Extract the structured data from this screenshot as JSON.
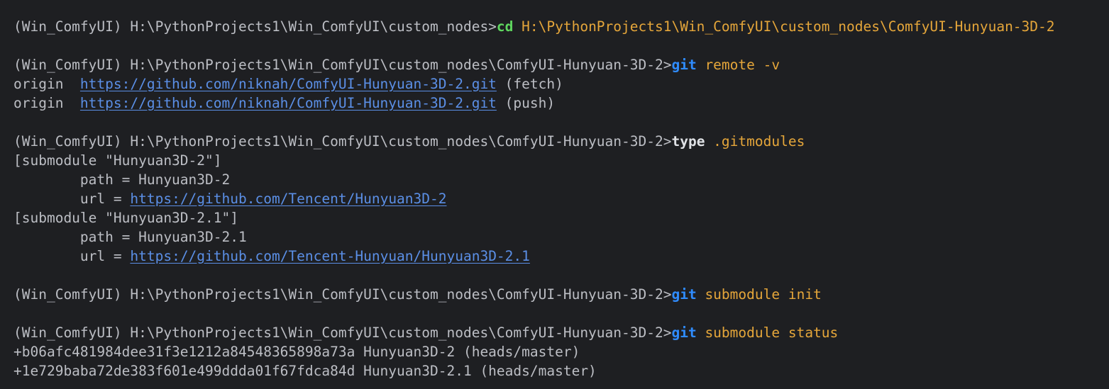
{
  "terminal": {
    "lines": [
      {
        "prompt": "(Win_ComfyUI) H:\\PythonProjects1\\Win_ComfyUI\\custom_nodes>",
        "command": "cd",
        "args": " H:\\PythonProjects1\\Win_ComfyUI\\custom_nodes\\ComfyUI-Hunyuan-3D-2"
      },
      {
        "prompt": "(Win_ComfyUI) H:\\PythonProjects1\\Win_ComfyUI\\custom_nodes\\ComfyUI-Hunyuan-3D-2>",
        "command": "git",
        "args": " remote -v"
      },
      {
        "pre": "origin  ",
        "link": "https://github.com/niknah/ComfyUI-Hunyuan-3D-2.git",
        "post": " (fetch)"
      },
      {
        "pre": "origin  ",
        "link": "https://github.com/niknah/ComfyUI-Hunyuan-3D-2.git",
        "post": " (push)"
      },
      {
        "prompt": "(Win_ComfyUI) H:\\PythonProjects1\\Win_ComfyUI\\custom_nodes\\ComfyUI-Hunyuan-3D-2>",
        "command": "type",
        "args": " .gitmodules"
      },
      {
        "text": "[submodule \"Hunyuan3D-2\"]"
      },
      {
        "text": "        path = Hunyuan3D-2"
      },
      {
        "pre": "        url = ",
        "link": "https://github.com/Tencent/Hunyuan3D-2"
      },
      {
        "text": "[submodule \"Hunyuan3D-2.1\"]"
      },
      {
        "text": "        path = Hunyuan3D-2.1"
      },
      {
        "pre": "        url = ",
        "link": "https://github.com/Tencent-Hunyuan/Hunyuan3D-2.1"
      },
      {
        "prompt": "(Win_ComfyUI) H:\\PythonProjects1\\Win_ComfyUI\\custom_nodes\\ComfyUI-Hunyuan-3D-2>",
        "command": "git",
        "args": " submodule init"
      },
      {
        "prompt": "(Win_ComfyUI) H:\\PythonProjects1\\Win_ComfyUI\\custom_nodes\\ComfyUI-Hunyuan-3D-2>",
        "command": "git",
        "args": " submodule status"
      },
      {
        "text": "+b06afc481984dee31f3e1212a84548365898a73a Hunyuan3D-2 (heads/master)"
      },
      {
        "text": "+1e729baba72de383f601e499ddda01f67fdca84d Hunyuan3D-2.1 (heads/master)"
      }
    ]
  }
}
